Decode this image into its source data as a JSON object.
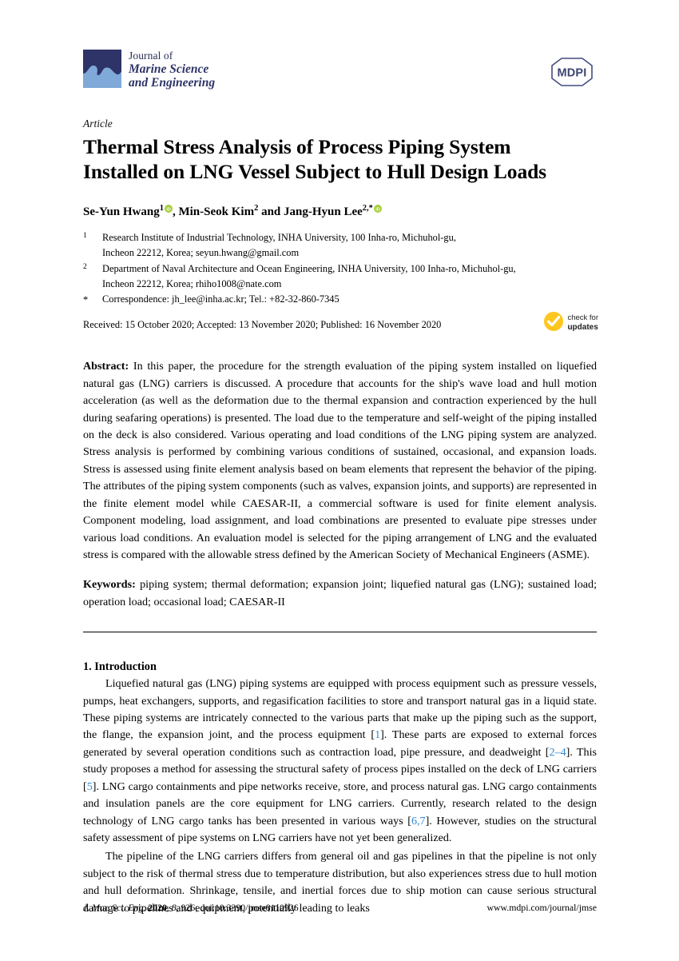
{
  "masthead": {
    "journal_of": "Journal of",
    "journal_title_line1": "Marine Science",
    "journal_title_line2": "and Engineering",
    "publisher_logo_text": "MDPI",
    "logo_icon": "wave-logo-icon"
  },
  "article": {
    "type": "Article",
    "title_line1": "Thermal Stress Analysis of Process Piping System",
    "title_line2": "Installed on LNG Vessel Subject to Hull Design Loads"
  },
  "authors": {
    "a1_name": "Se-Yun Hwang",
    "a1_sup": "1",
    "a2_name": "Min-Seok Kim",
    "a2_sup": "2",
    "a3_name": "Jang-Hyun Lee",
    "a3_sup": "2,*",
    "sep1": ", ",
    "sep2": " and ",
    "orcid_icon": "orcid-id-icon"
  },
  "affiliations": [
    {
      "mark": "1",
      "line1": "Research Institute of Industrial Technology, INHA University, 100 Inha-ro, Michuhol-gu,",
      "line2": "Incheon 22212, Korea; seyun.hwang@gmail.com"
    },
    {
      "mark": "2",
      "line1": "Department of Naval Architecture and Ocean Engineering, INHA University, 100 Inha-ro, Michuhol-gu,",
      "line2": "Incheon 22212, Korea; rhiho1008@nate.com"
    },
    {
      "mark": "*",
      "line1": "Correspondence: jh_lee@inha.ac.kr; Tel.: +82-32-860-7345",
      "line2": ""
    }
  ],
  "dates": {
    "line": "Received: 15 October 2020; Accepted: 13 November 2020; Published: 16 November 2020",
    "check_for": "check for",
    "updates": "updates",
    "badge_icon": "check-for-updates-icon",
    "badge_color": "#FFC61E"
  },
  "abstract": {
    "label": "Abstract:",
    "text": " In this paper, the procedure for the strength evaluation of the piping system installed on liquefied natural gas (LNG) carriers is discussed. A procedure that accounts for the ship's wave load and hull motion acceleration (as well as the deformation due to the thermal expansion and contraction experienced by the hull during seafaring operations) is presented. The load due to the temperature and self-weight of the piping installed on the deck is also considered. Various operating and load conditions of the LNG piping system are analyzed. Stress analysis is performed by combining various conditions of sustained, occasional, and expansion loads. Stress is assessed using finite element analysis based on beam elements that represent the behavior of the piping. The attributes of the piping system components (such as valves, expansion joints, and supports) are represented in the finite element model while CAESAR-II, a commercial software is used for finite element analysis. Component modeling, load assignment, and load combinations are presented to evaluate pipe stresses under various load conditions. An evaluation model is selected for the piping arrangement of LNG and the evaluated stress is compared with the allowable stress defined by the American Society of Mechanical Engineers (ASME)."
  },
  "keywords": {
    "label": "Keywords:",
    "text": "  piping system; thermal deformation; expansion joint; liquefied natural gas (LNG); sustained load; operation load; occasional load; CAESAR-II"
  },
  "introduction": {
    "heading": "1. Introduction",
    "p1_a": "Liquefied natural gas (LNG) piping systems are equipped with process equipment such as pressure vessels, pumps, heat exchangers, supports, and regasification facilities to store and transport natural gas in a liquid state. These piping systems are intricately connected to the various parts that make up the piping such as the support, the flange, the expansion joint, and the process equipment [",
    "p1_cite1": "1",
    "p1_b": "]. These parts are exposed to external forces generated by several operation conditions such as contraction load, pipe pressure, and deadweight [",
    "p1_cite2": "2–4",
    "p1_c": "]. This study proposes a method for assessing the structural safety of process pipes installed on the deck of LNG carriers [",
    "p1_cite3": "5",
    "p1_d": "]. LNG cargo containments and pipe networks receive, store, and process natural gas. LNG cargo containments and insulation panels are the core equipment for LNG carriers. Currently, research related to the design technology of LNG cargo tanks has been presented in various ways [",
    "p1_cite4": "6,7",
    "p1_e": "]. However, studies on the structural safety assessment of pipe systems on LNG carriers have not yet been generalized.",
    "p2": "The pipeline of the LNG carriers differs from general oil and gas pipelines in that the pipeline is not only subject to the risk of thermal stress due to temperature distribution, but also experiences stress due to hull motion and hull deformation. Shrinkage, tensile, and inertial forces due to ship motion can cause serious structural damage to pipelines and equipment, potentially leading to leaks"
  },
  "footer": {
    "journal_abbrev": "J. Mar. Sci. Eng.",
    "year": "2020",
    "volume": "8",
    "article_no": "926",
    "doi": "doi:10.3390/jmse8110926",
    "url": "www.mdpi.com/journal/jmse"
  },
  "colors": {
    "brand_navy": "#2e3467",
    "wave_blue": "#7fa9d8",
    "citation_blue": "#2f88d4",
    "orcid_green": "#A6CE39",
    "badge_yellow": "#FFC61E"
  }
}
